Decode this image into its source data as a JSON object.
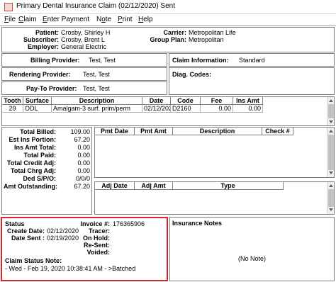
{
  "window": {
    "title": "Primary Dental Insurance Claim (02/12/2020) Sent"
  },
  "menu": [
    "File",
    "Claim",
    "Enter Payment",
    "Note",
    "Print",
    "Help"
  ],
  "menu_underline": [
    "F",
    "C",
    "E",
    "o",
    "P",
    "H"
  ],
  "header": {
    "patient_label": "Patient:",
    "patient": "Crosby, Shirley H",
    "subscriber_label": "Subscriber:",
    "subscriber": "Crosby, Brent L",
    "employer_label": "Employer:",
    "employer": "General Electric",
    "carrier_label": "Carrier:",
    "carrier": "Metropolitan Life",
    "group_label": "Group Plan:",
    "group": "Metropolitan"
  },
  "providers": {
    "billing_label": "Billing Provider:",
    "billing": "Test, Test",
    "rendering_label": "Rendering Provider:",
    "rendering": "Test, Test",
    "payto_label": "Pay-To Provider:",
    "payto": "Test, Test"
  },
  "claim_info": {
    "label": "Claim Information:",
    "value": "Standard",
    "diag_label": "Diag. Codes:"
  },
  "procedures": {
    "columns": [
      "Tooth",
      "Surface",
      "Description",
      "Date",
      "Code",
      "Fee",
      "Ins Amt"
    ],
    "rows": [
      [
        "29",
        "ODL",
        "Amalgam-3 surf. prim/perm",
        "02/12/2020",
        "D2160",
        "0.00",
        "0.00"
      ]
    ]
  },
  "totals": {
    "billed_label": "Total Billed:",
    "billed": "109.00",
    "est_label": "Est Ins Portion:",
    "est": "67.20",
    "ins_amt_label": "Ins Amt Total:",
    "ins_amt": "0.00",
    "paid_label": "Total Paid:",
    "paid": "0.00",
    "credit_label": "Total Credit Adj:",
    "credit": "0.00",
    "chrg_label": "Total Chrg Adj:",
    "chrg": "0.00",
    "ded_label": "Ded S/P/O:",
    "ded": "0/0/0",
    "outstanding_label": "Amt Outstanding:",
    "outstanding": "67.20"
  },
  "payments": {
    "columns": [
      "Pmt Date",
      "Pmt Amt",
      "Description",
      "Check #"
    ]
  },
  "adjustments": {
    "columns": [
      "Adj Date",
      "Adj Amt",
      "Type"
    ]
  },
  "status": {
    "label": "Status",
    "invoice_label": "Invoice #:",
    "invoice": "176365906",
    "create_label": "Create Date:",
    "create": "02/12/2020",
    "sent_label": "Date Sent :",
    "sent": "02/19/2020",
    "tracer_label": "Tracer:",
    "onhold_label": "On Hold:",
    "resent_label": "Re-Sent:",
    "voided_label": "Voided:",
    "note_label": "Claim Status Note:",
    "note": "- Wed - Feb 19, 2020 10:38:41 AM - >Batched",
    "highlight_color": "#d9262b"
  },
  "insurance_notes": {
    "label": "Insurance Notes",
    "empty_text": "(No Note)"
  }
}
